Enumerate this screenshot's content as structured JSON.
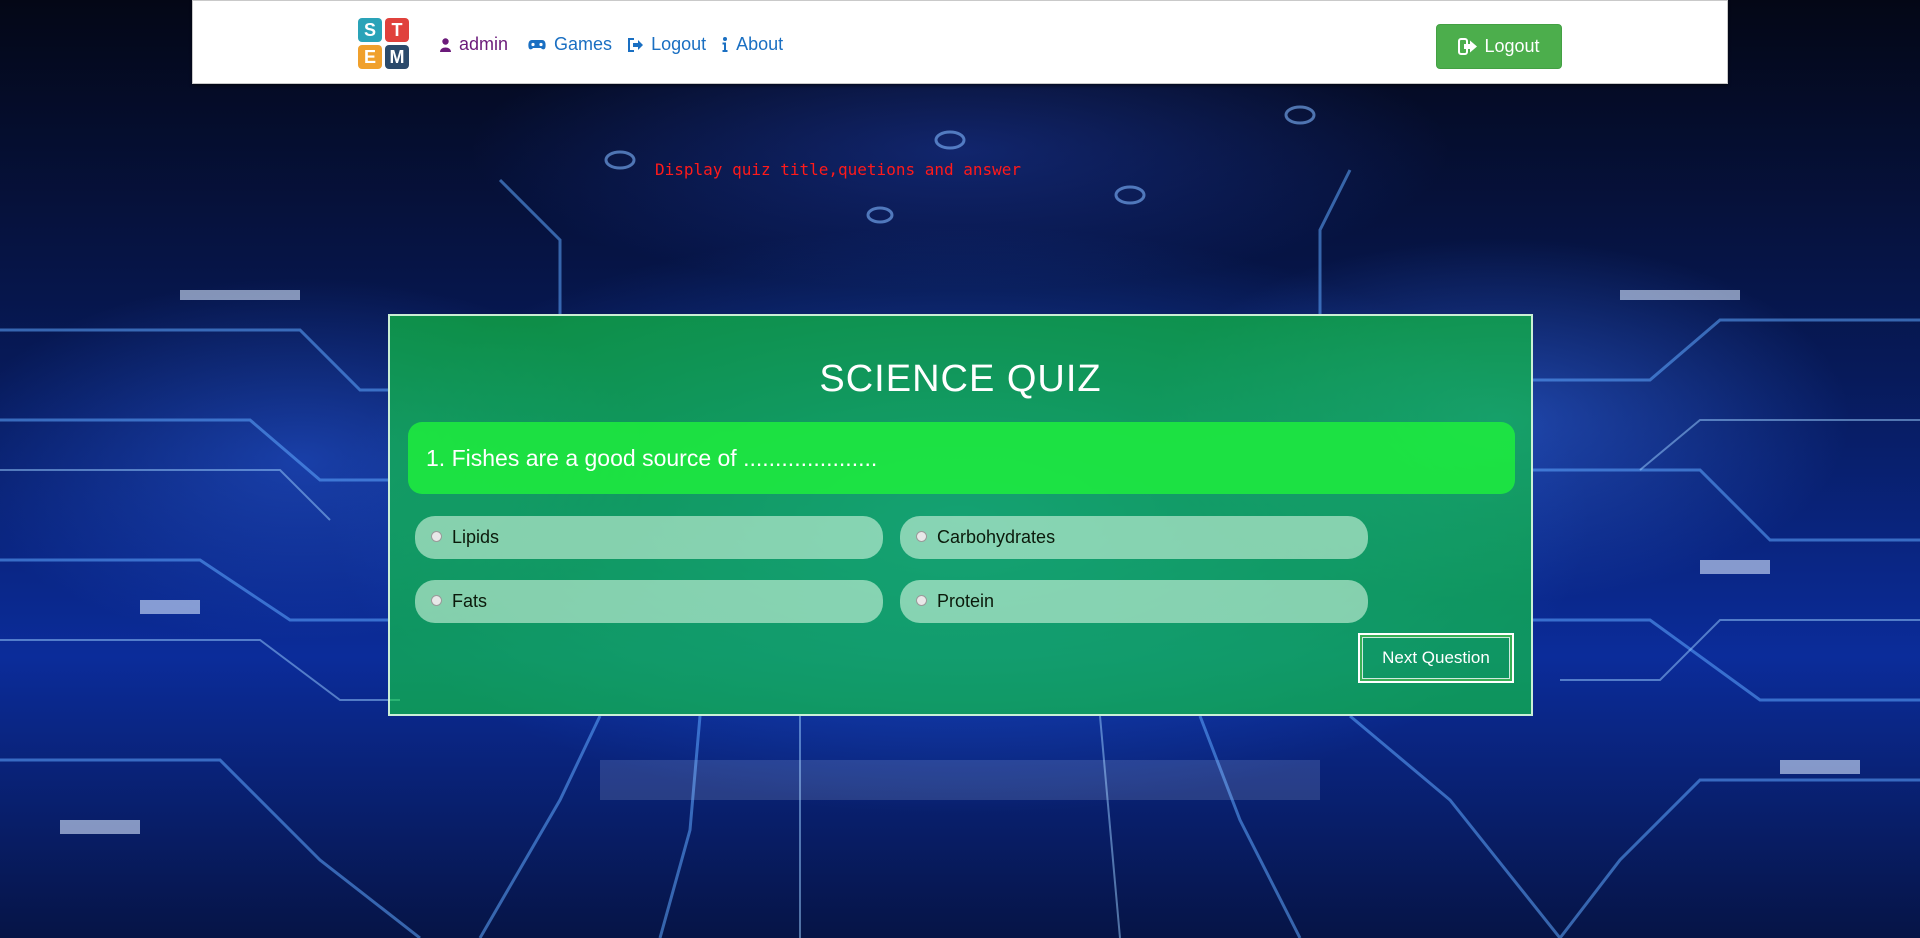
{
  "logo": {
    "letters": [
      "S",
      "T",
      "E",
      "M"
    ],
    "colors": [
      "#2aa3b8",
      "#e0413c",
      "#f0a02c",
      "#2b4a6b"
    ]
  },
  "nav": {
    "user": {
      "label": "admin",
      "icon": "user-icon"
    },
    "items": [
      {
        "label": "Games",
        "icon": "gamepad-icon"
      },
      {
        "label": "Logout",
        "icon": "sign-out-icon"
      },
      {
        "label": "About",
        "icon": "info-icon"
      }
    ],
    "logout_button": {
      "label": "Logout",
      "icon": "sign-out-icon",
      "color": "#4cae4c"
    }
  },
  "caption": "Display quiz title,quetions and answer",
  "quiz": {
    "title": "SCIENCE QUIZ",
    "question": "1. Fishes are a good source of .....................",
    "options": [
      "Lipids",
      "Carbohydrates",
      "Fats",
      "Protein"
    ],
    "next_label": "Next Question"
  }
}
